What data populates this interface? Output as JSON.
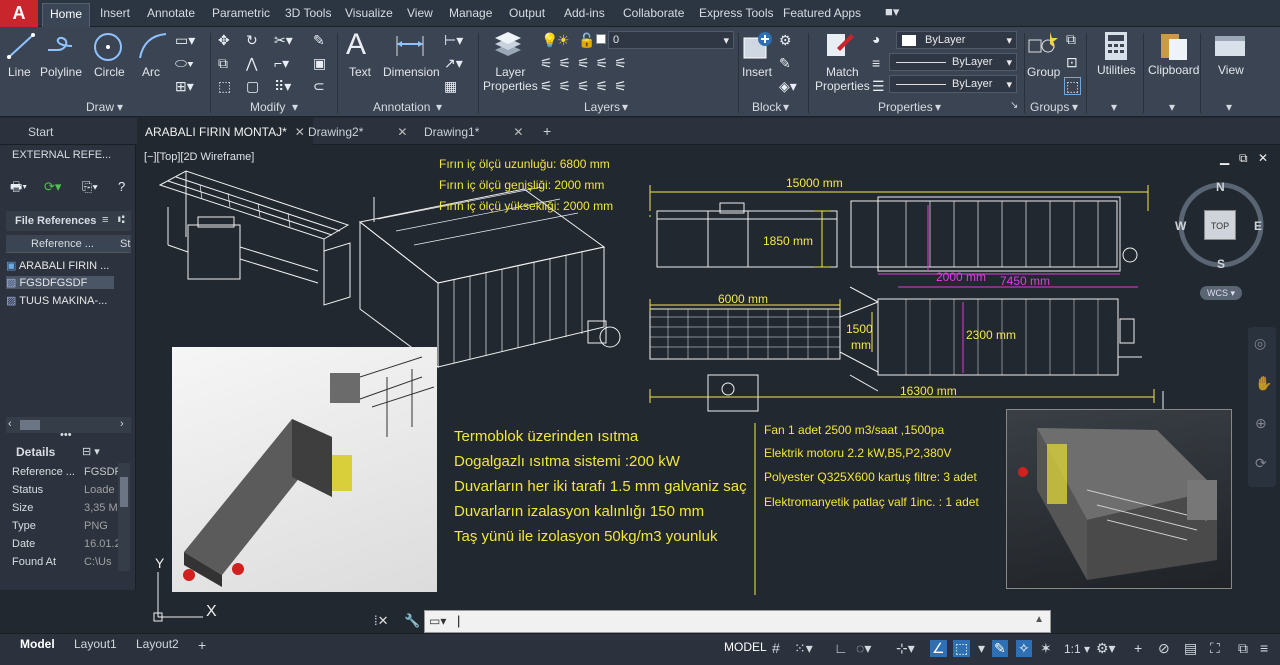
{
  "ribbon_tabs": [
    "Home",
    "Insert",
    "Annotate",
    "Parametric",
    "3D Tools",
    "Visualize",
    "View",
    "Manage",
    "Output",
    "Add-ins",
    "Collaborate",
    "Express Tools",
    "Featured Apps"
  ],
  "draw": {
    "tools": [
      "Line",
      "Polyline",
      "Circle",
      "Arc"
    ],
    "panel": "Draw"
  },
  "modify": {
    "panel": "Modify"
  },
  "annotation": {
    "text": "Text",
    "dimension": "Dimension",
    "panel": "Annotation"
  },
  "layers": {
    "layer_properties": "Layer\nProperties",
    "current_layer": "0",
    "panel": "Layers"
  },
  "block": {
    "insert": "Insert",
    "panel": "Block"
  },
  "properties": {
    "match": "Match\nProperties",
    "color": "ByLayer",
    "linetype": "ByLayer",
    "lineweight": "ByLayer",
    "panel": "Properties"
  },
  "groups": {
    "group": "Group",
    "panel": "Groups"
  },
  "utilities": "Utilities",
  "clipboard": "Clipboard",
  "view": "View",
  "doc_tabs": [
    "Start",
    "ARABALI FIRIN MONTAJ*",
    "Drawing2*",
    "Drawing1*"
  ],
  "xref": {
    "title": "EXTERNAL REFE...",
    "file_refs": "File References",
    "col_ref": "Reference ...",
    "col_st": "St",
    "items": [
      "ARABALI FIRIN ...",
      "FGSDFGSDF",
      "TUUS MAKINA-..."
    ],
    "details_title": "Details",
    "details": [
      {
        "k": "Reference ...",
        "v": "FGSDF"
      },
      {
        "k": "Status",
        "v": "Loade"
      },
      {
        "k": "Size",
        "v": "3,35 M"
      },
      {
        "k": "Type",
        "v": "PNG"
      },
      {
        "k": "Date",
        "v": "16.01.2"
      },
      {
        "k": "Found At",
        "v": "C:\\Us"
      }
    ]
  },
  "viewport_label": "[−][Top][2D Wireframe]",
  "notes_top": [
    "Fırın iç ölçü uzunluğu: 6800 mm",
    "Fırın iç ölçü genişliği: 2000 mm",
    "Fırın iç ölçü yüksekliği: 2000 mm"
  ],
  "dims": {
    "d15000": "15000 mm",
    "d1850": "1850 mm",
    "d2000": "2000 mm",
    "d7450": "7450 mm",
    "d6000": "6000 mm",
    "d1500a": "1500",
    "d1500b": "mm",
    "d2300": "2300 mm",
    "d16300": "16300 mm"
  },
  "notes_mid": [
    "Termoblok üzerinden ısıtma",
    "Dogalgazlı ısıtma sistemi :200 kW",
    "Duvarların her iki tarafı 1.5 mm galvaniz saç",
    "Duvarların izalasyon kalınlığı 150 mm",
    "Taş yünü ile izolasyon 50kg/m3 younluk"
  ],
  "notes_right": [
    "Fan 1 adet 2500 m3/saat ,1500pa",
    "Elektrik motoru 2.2 kW,B5,P2,380V",
    "Polyester Q325X600 kartuş filtre: 3 adet",
    "Elektromanyetik patlaç valf 1inc. : 1 adet"
  ],
  "viewcube": {
    "n": "N",
    "s": "S",
    "e": "E",
    "w": "W",
    "top": "TOP",
    "wcs": "WCS"
  },
  "ucs": {
    "x": "X",
    "y": "Y"
  },
  "layout_tabs": [
    "Model",
    "Layout1",
    "Layout2"
  ],
  "status": {
    "model": "MODEL",
    "scale": "1:1"
  },
  "colors": {
    "annotation": "#f2e63b",
    "dimension_magenta": "#e03ce0",
    "ribbon_bg": "#3b4453",
    "canvas_bg": "#212830"
  }
}
